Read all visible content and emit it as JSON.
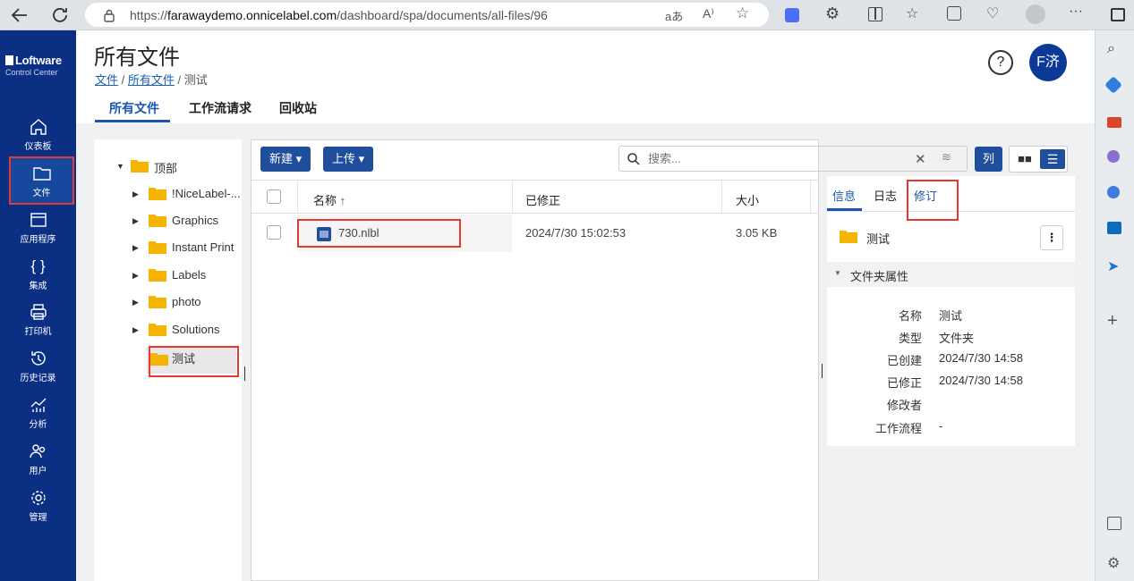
{
  "browser": {
    "url_prefix": "https://",
    "url_host": "farawaydemo.onnicelabel.com",
    "url_path": "/dashboard/spa/documents/all-files/96"
  },
  "app": {
    "logo_name": "Loftware",
    "logo_sub": "Control Center",
    "nav": [
      {
        "label": "仪表板",
        "icon": "home-icon"
      },
      {
        "label": "文件",
        "icon": "folder-icon"
      },
      {
        "label": "应用程序",
        "icon": "window-icon"
      },
      {
        "label": "集成",
        "icon": "braces-icon"
      },
      {
        "label": "打印机",
        "icon": "printer-icon"
      },
      {
        "label": "历史记录",
        "icon": "history-icon"
      },
      {
        "label": "分析",
        "icon": "chart-icon"
      },
      {
        "label": "用户",
        "icon": "users-icon"
      },
      {
        "label": "管理",
        "icon": "gear-icon"
      }
    ],
    "user_initials": "F济"
  },
  "header": {
    "title": "所有文件",
    "breadcrumb": [
      "文件",
      "所有文件",
      "测试"
    ],
    "separator": "/"
  },
  "tabs": [
    "所有文件",
    "工作流请求",
    "回收站"
  ],
  "tree": {
    "root": "顶部",
    "items": [
      "!NiceLabel-...",
      "Graphics",
      "Instant Print",
      "Labels",
      "photo",
      "Solutions",
      "测试"
    ]
  },
  "toolbar": {
    "new_label": "新建",
    "upload_label": "上传",
    "search_placeholder": "搜索...",
    "columns_label": "列"
  },
  "list": {
    "headers": {
      "name": "名称",
      "sort": "↑",
      "modified": "已修正",
      "size": "大小"
    },
    "rows": [
      {
        "name": "730.nlbl",
        "modified": "2024/7/30 15:02:53",
        "size": "3.05 KB"
      }
    ]
  },
  "detail": {
    "tabs": [
      "信息",
      "日志",
      "修订"
    ],
    "folder_name": "测试",
    "section_title": "文件夹属性",
    "props": [
      {
        "key": "名称",
        "value": "测试"
      },
      {
        "key": "类型",
        "value": "文件夹"
      },
      {
        "key": "已创建",
        "value": "2024/7/30 14:58"
      },
      {
        "key": "已修正",
        "value": "2024/7/30 14:58"
      },
      {
        "key": "修改者",
        "value": ""
      },
      {
        "key": "工作流程",
        "value": "-"
      }
    ]
  },
  "colors": {
    "nav_bg": "#0a2f83",
    "accent": "#1f4e9c",
    "folder": "#f5b400",
    "highlight": "#e53935"
  }
}
